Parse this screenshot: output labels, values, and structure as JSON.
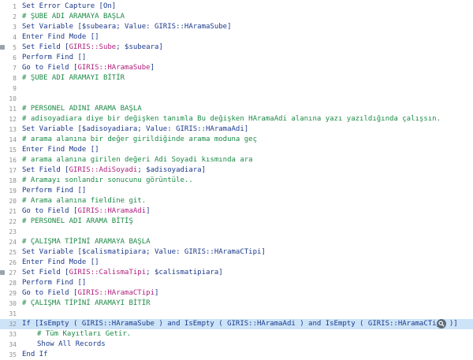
{
  "lines": [
    {
      "n": "1",
      "text": "Set Error Capture [On]",
      "kind": "kw"
    },
    {
      "n": "2",
      "text": "# ŞUBE ADI ARAMAYA BAŞLA",
      "kind": "cm"
    },
    {
      "n": "3",
      "text": "Set Variable [$subeara; Value: GIRIS::HAramaSube]",
      "kind": "kw"
    },
    {
      "n": "4",
      "text": "Enter Find Mode []",
      "kind": "kw"
    },
    {
      "n": "5",
      "pre": "Set Field [",
      "field": "GIRIS::Sube",
      "post": "; $subeara]",
      "kind": "field"
    },
    {
      "n": "6",
      "text": "Perform Find []",
      "kind": "kw"
    },
    {
      "n": "7",
      "pre": "Go to Field [",
      "field": "GIRIS::HAramaSube",
      "post": "]",
      "kind": "field"
    },
    {
      "n": "8",
      "text": "# ŞUBE ADI ARAMAYI BİTİR",
      "kind": "cm"
    },
    {
      "n": "9",
      "text": "",
      "kind": "kw"
    },
    {
      "n": "10",
      "text": "",
      "kind": "kw"
    },
    {
      "n": "11",
      "text": "# PERSONEL ADINI ARAMA BAŞLA",
      "kind": "cm"
    },
    {
      "n": "12",
      "text": "# adisoyadiara diye bir değişken tanımla Bu değişken HAramaAdi alanına yazı yazıldığında çalışsın.",
      "kind": "cm"
    },
    {
      "n": "13",
      "text": "Set Variable [$adisoyadiara; Value: GIRIS::HAramaAdi]",
      "kind": "kw"
    },
    {
      "n": "14",
      "text": "# arama alanına bir değer girildiğinde arama moduna geç",
      "kind": "cm"
    },
    {
      "n": "15",
      "text": "Enter Find Mode []",
      "kind": "kw"
    },
    {
      "n": "16",
      "text": "# arama alanına girilen değeri Adi Soyadi kısmında ara",
      "kind": "cm"
    },
    {
      "n": "17",
      "pre": "Set Field [",
      "field": "GIRIS::AdiSoyadi",
      "post": "; $adisoyadiara]",
      "kind": "field"
    },
    {
      "n": "18",
      "text": "# Aramayı sonlandır sonucunu görüntüle..",
      "kind": "cm"
    },
    {
      "n": "19",
      "text": "Perform Find []",
      "kind": "kw"
    },
    {
      "n": "20",
      "text": "# Arama alanına fieldine git.",
      "kind": "cm"
    },
    {
      "n": "21",
      "pre": "Go to Field [",
      "field": "GIRIS::HAramaAdi",
      "post": "]",
      "kind": "field"
    },
    {
      "n": "22",
      "text": "# PERSONEL ADI ARAMA BİTİŞ",
      "kind": "cm"
    },
    {
      "n": "23",
      "text": "",
      "kind": "kw"
    },
    {
      "n": "24",
      "text": "# ÇALIŞMA TİPİNİ ARAMAYA BAŞLA",
      "kind": "cm"
    },
    {
      "n": "25",
      "text": "Set Variable [$calismatipiara; Value: GIRIS::HAramaCTipi]",
      "kind": "kw"
    },
    {
      "n": "26",
      "text": "Enter Find Mode []",
      "kind": "kw"
    },
    {
      "n": "27",
      "pre": "Set Field [",
      "field": "GIRIS::CalismaTipi",
      "post": "; $calismatipiara]",
      "kind": "field"
    },
    {
      "n": "28",
      "text": "Perform Find []",
      "kind": "kw"
    },
    {
      "n": "29",
      "pre": "Go to Field [",
      "field": "GIRIS::HAramaCTipi",
      "post": "]",
      "kind": "field"
    },
    {
      "n": "30",
      "text": "# ÇALIŞMA TİPİNİ ARAMAYI BİTİR",
      "kind": "cm"
    },
    {
      "n": "31",
      "text": "",
      "kind": "kw"
    },
    {
      "n": "32",
      "text": "If [IsEmpty ( GIRIS::HAramaSube ) and IsEmpty ( GIRIS::HAramaAdi ) and IsEmpty ( GIRIS::HAramaCTipi )]",
      "kind": "kw",
      "selected": true
    },
    {
      "n": "33",
      "text": "# Tüm Kayıtları Getir.",
      "kind": "cm",
      "indent": true
    },
    {
      "n": "34",
      "text": "Show All Records",
      "kind": "kw",
      "indent": true
    },
    {
      "n": "35",
      "text": "End If",
      "kind": "kw"
    }
  ],
  "colors": {
    "keyword": "#1c3a8c",
    "comment": "#1c8a46",
    "field_reference": "#b0207d",
    "selection": "#cde4f8"
  },
  "icons": {
    "collapse_markers": "collapse-marker-icon",
    "line_action": "magnifier-icon"
  }
}
